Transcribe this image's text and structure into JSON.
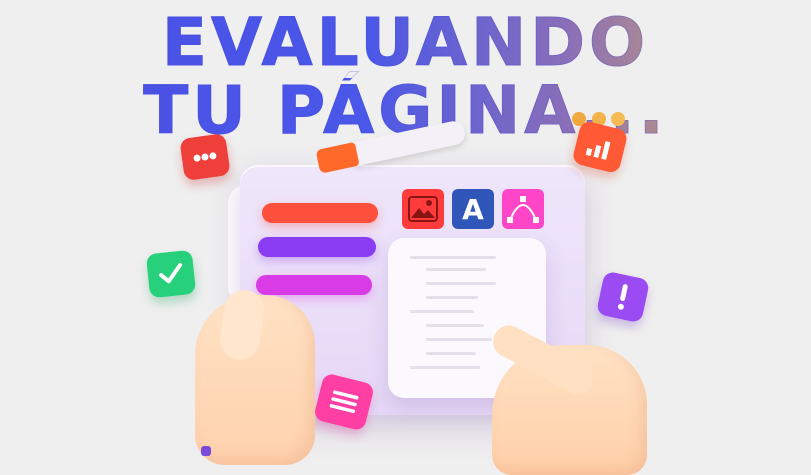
{
  "headline": {
    "line1": "EVALUANDO",
    "line2": "TU PÁGINA..."
  },
  "toolbar": {
    "text_tool_letter": "A"
  },
  "colors": {
    "headline_gradient_start": "#4a4fe3",
    "headline_gradient_end": "#e6b84f",
    "bar_red": "#ff4f3d",
    "bar_purple": "#8a3cf2",
    "bar_magenta": "#d93be6",
    "background": "#efefef"
  },
  "icons": [
    "image-icon",
    "text-tool-icon",
    "vector-pen-icon",
    "chat-bubble-icon",
    "bar-chart-icon",
    "checkmark-icon",
    "exclamation-icon",
    "text-lines-icon",
    "pencil-icon"
  ]
}
